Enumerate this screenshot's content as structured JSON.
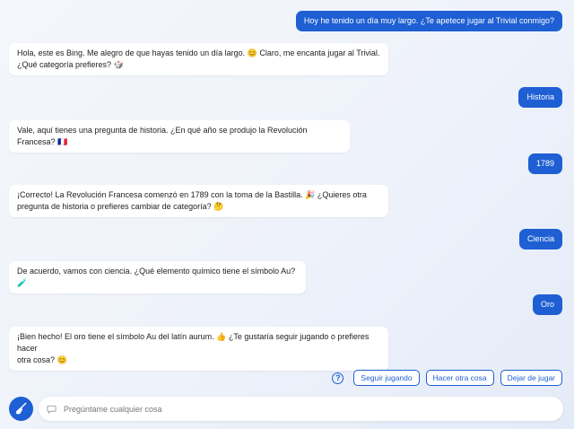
{
  "messages": [
    {
      "role": "user",
      "text": "Hoy he tenido un día muy largo. ¿Te apetece jugar al Trivial conmigo?"
    },
    {
      "role": "bot",
      "lines": [
        "Hola, este es Bing. Me alegro de que hayas tenido un día largo. 😊 Claro, me encanta jugar al Trivial.",
        "¿Qué categoría prefieres? 🎲"
      ]
    },
    {
      "role": "user",
      "text": "Historia"
    },
    {
      "role": "bot",
      "lines": [
        "Vale, aquí tienes una pregunta de historia. ¿En qué año se produjo la Revolución Francesa? 🇫🇷"
      ]
    },
    {
      "role": "user",
      "text": "1789"
    },
    {
      "role": "bot",
      "lines": [
        "¡Correcto! La Revolución Francesa comenzó en 1789 con la toma de la Bastilla. 🎉 ¿Quieres otra",
        "pregunta de historia o prefieres cambiar de categoría? 🤔"
      ]
    },
    {
      "role": "user",
      "text": "Ciencia"
    },
    {
      "role": "bot",
      "lines": [
        "De acuerdo, vamos con ciencia. ¿Qué elemento químico tiene el símbolo Au? 🧪"
      ]
    },
    {
      "role": "user",
      "text": "Oro"
    },
    {
      "role": "bot",
      "lines": [
        "¡Bien hecho! El oro tiene el símbolo Au del latín aurum. 👍 ¿Te gustaría seguir jugando o prefieres hacer",
        "otra cosa? 😊"
      ]
    }
  ],
  "suggestions": [
    "Seguir jugando",
    "Hacer otra cosa",
    "Dejar de jugar"
  ],
  "input": {
    "placeholder": "Pregúntame cualquier cosa"
  },
  "icons": {
    "help": "question-circle-icon",
    "new_topic": "broom-icon",
    "input": "chat-bubble-icon"
  },
  "colors": {
    "accent": "#1e5fd3",
    "bot_bubble": "#ffffff",
    "user_text": "#ffffff"
  }
}
